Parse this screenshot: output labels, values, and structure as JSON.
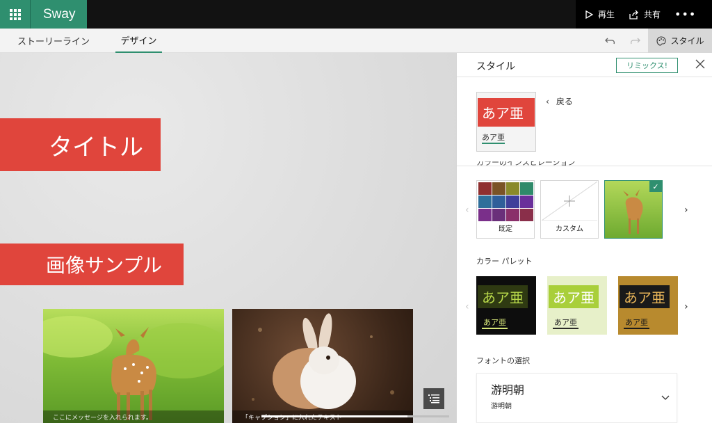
{
  "app": {
    "name": "Sway"
  },
  "toolbar": {
    "play_label": "再生",
    "share_label": "共有",
    "more_label": "•••"
  },
  "tabs": [
    {
      "label": "ストーリーライン",
      "active": false
    },
    {
      "label": "デザイン",
      "active": true
    }
  ],
  "style_button_label": "スタイル",
  "canvas": {
    "title": "タイトル",
    "heading": "画像サンプル",
    "captions": [
      "ここにメッセージを入れられます。",
      "「キャプション」に入れたテキスト"
    ]
  },
  "panel": {
    "title": "スタイル",
    "remix_label": "リミックス!",
    "back_label": "戻る",
    "sample_text": "あア亜",
    "cut_label": "カラーのインスピレーション",
    "color_options": [
      {
        "label": "既定"
      },
      {
        "label": "カスタム"
      },
      {
        "label": "",
        "selected": true
      }
    ],
    "color_palette_label": "カラー パレット",
    "palettes": [
      {
        "bg": "#0d0d0d",
        "text_bg": "#2f3a12",
        "text": "#b8d84a",
        "sub_bg": "#0d0d0d",
        "sub": "#d8e87a"
      },
      {
        "bg": "#e7f0c9",
        "text_bg": "#a9cf3a",
        "text": "#ffffff",
        "sub_bg": "#e7f0c9",
        "sub": "#2a2a2a"
      },
      {
        "bg": "#b88a2e",
        "text_bg": "#1a1a1a",
        "text": "#e7b458",
        "sub_bg": "#b88a2e",
        "sub": "#1a1a1a"
      }
    ],
    "font_section_label": "フォントの選択",
    "font": {
      "name": "游明朝",
      "sub": "游明朝"
    }
  },
  "colors": {
    "accent": "#2f8f6f",
    "title_block": "#e0453c",
    "swatches": [
      "#8f2f2f",
      "#7a5326",
      "#8a8a2a",
      "#2f8a6a",
      "#2f6f9a",
      "#2f5f9a",
      "#3f3f9a",
      "#6a2f9a",
      "#7a2f8a",
      "#6a2f7a",
      "#8a2f6a",
      "#8a2f4a"
    ]
  }
}
